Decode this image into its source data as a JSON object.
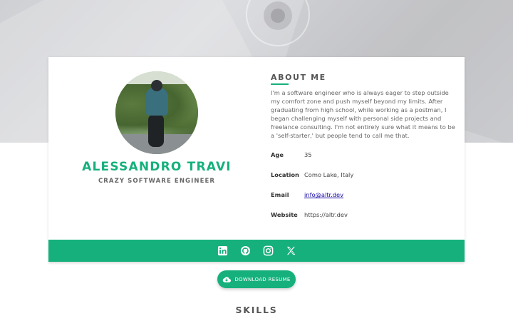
{
  "profile": {
    "name": "ALESSANDRO TRAVI",
    "subtitle": "CRAZY SOFTWARE ENGINEER"
  },
  "about": {
    "title": "ABOUT ME",
    "text": "I'm a software engineer who is always eager to step outside my comfort zone and push myself beyond my limits. After graduating from high school, while working as a postman, I began challenging myself with personal side projects and freelance consulting. I'm not entirely sure what it means to be a 'self-starter,' but people tend to call me that.",
    "details": [
      {
        "label": "Age",
        "value": "35"
      },
      {
        "label": "Location",
        "value": "Como Lake, Italy"
      },
      {
        "label": "Email",
        "value": "info@altr.dev"
      },
      {
        "label": "Website",
        "value": "https://altr.dev"
      }
    ]
  },
  "social": {
    "icons": [
      "linkedin-icon",
      "github-icon",
      "instagram-icon",
      "x-icon"
    ]
  },
  "download_button": {
    "label": "DOWNLOAD RESUME",
    "icon": "cloud-download-icon"
  },
  "skills": {
    "title": "SKILLS"
  },
  "colors": {
    "accent": "#16b07c",
    "heading": "#555555",
    "body_text": "#666666",
    "link": "#1a0dab"
  }
}
